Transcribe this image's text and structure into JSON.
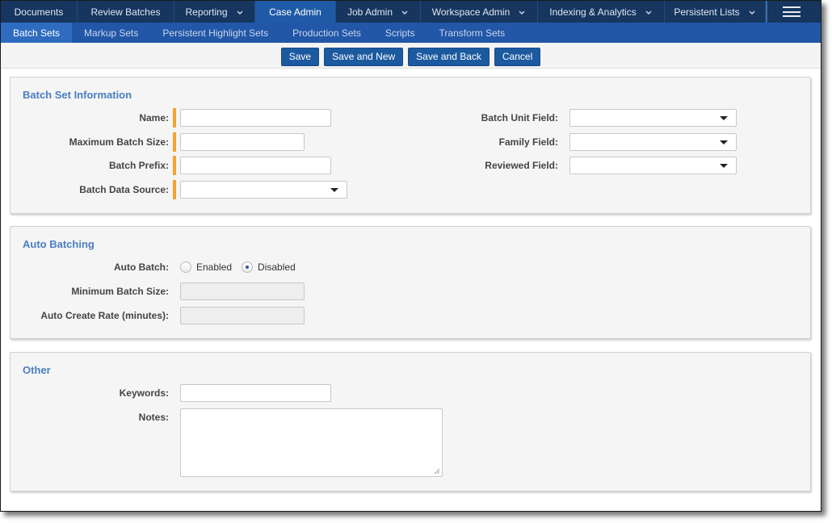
{
  "topnav": {
    "tabs": [
      {
        "label": "Documents",
        "dropdown": false,
        "active": false
      },
      {
        "label": "Review Batches",
        "dropdown": false,
        "active": false
      },
      {
        "label": "Reporting",
        "dropdown": true,
        "active": false
      },
      {
        "label": "Case Admin",
        "dropdown": false,
        "active": true
      },
      {
        "label": "Job Admin",
        "dropdown": true,
        "active": false
      },
      {
        "label": "Workspace Admin",
        "dropdown": true,
        "active": false
      },
      {
        "label": "Indexing & Analytics",
        "dropdown": true,
        "active": false
      },
      {
        "label": "Persistent Lists",
        "dropdown": true,
        "active": false
      }
    ],
    "menu_icon": "hamburger-menu-icon"
  },
  "subnav": {
    "tabs": [
      {
        "label": "Batch Sets",
        "active": true
      },
      {
        "label": "Markup Sets",
        "active": false
      },
      {
        "label": "Persistent Highlight Sets",
        "active": false
      },
      {
        "label": "Production Sets",
        "active": false
      },
      {
        "label": "Scripts",
        "active": false
      },
      {
        "label": "Transform Sets",
        "active": false
      }
    ]
  },
  "toolbar": {
    "save_label": "Save",
    "save_and_new_label": "Save and New",
    "save_and_back_label": "Save and Back",
    "cancel_label": "Cancel"
  },
  "batch_set_info": {
    "title": "Batch Set Information",
    "name_label": "Name:",
    "name_value": "",
    "max_batch_size_label": "Maximum Batch Size:",
    "max_batch_size_value": "",
    "batch_prefix_label": "Batch Prefix:",
    "batch_prefix_value": "",
    "batch_data_source_label": "Batch Data Source:",
    "batch_data_source_value": "",
    "batch_unit_field_label": "Batch Unit Field:",
    "batch_unit_field_value": "",
    "family_field_label": "Family Field:",
    "family_field_value": "",
    "reviewed_field_label": "Reviewed Field:",
    "reviewed_field_value": ""
  },
  "auto_batching": {
    "title": "Auto Batching",
    "auto_batch_label": "Auto Batch:",
    "options": [
      "Enabled",
      "Disabled"
    ],
    "selected": "Disabled",
    "min_batch_size_label": "Minimum Batch Size:",
    "min_batch_size_value": "",
    "auto_create_rate_label": "Auto Create Rate (minutes):",
    "auto_create_rate_value": ""
  },
  "other": {
    "title": "Other",
    "keywords_label": "Keywords:",
    "keywords_value": "",
    "notes_label": "Notes:",
    "notes_value": ""
  },
  "colors": {
    "topnav_bg": "#16365f",
    "active_tab": "#1f5aa6",
    "subnav_bg": "#2256a6",
    "button_bg": "#1c5aa0",
    "section_title": "#4a7ec0",
    "required_marker": "#f3a32f"
  }
}
